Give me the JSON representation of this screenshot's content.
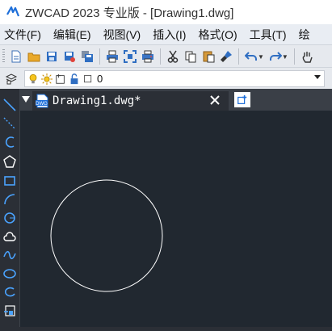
{
  "window": {
    "title": "ZWCAD 2023 专业版 - [Drawing1.dwg]"
  },
  "menubar": {
    "items": [
      {
        "label": "文件(F)"
      },
      {
        "label": "编辑(E)"
      },
      {
        "label": "视图(V)"
      },
      {
        "label": "插入(I)"
      },
      {
        "label": "格式(O)"
      },
      {
        "label": "工具(T)"
      },
      {
        "label": "绘"
      }
    ]
  },
  "layer_toolbar": {
    "current_layer": "0"
  },
  "document_tab": {
    "label": "Drawing1.dwg*",
    "icon_text": "DWG"
  },
  "colors": {
    "canvas": "#212830",
    "accent": "#1e6fd9"
  }
}
